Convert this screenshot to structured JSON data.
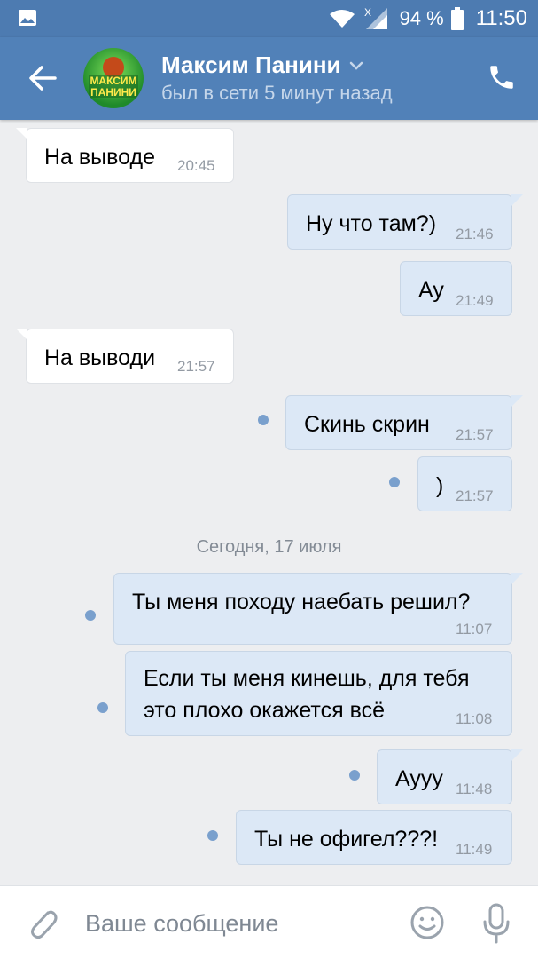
{
  "status_bar": {
    "battery_percent": "94 %",
    "time": "11:50"
  },
  "header": {
    "contact_name": "Максим Панини",
    "contact_status": "был в сети 5 минут назад",
    "avatar_text_line1": "МАКСИМ",
    "avatar_text_line2": "ПАНИНИ"
  },
  "messages": [
    {
      "direction": "in",
      "text": "На выводе",
      "time": "20:45"
    },
    {
      "direction": "out",
      "text": "Ну что там?)",
      "time": "21:46"
    },
    {
      "direction": "out",
      "text": "Ау",
      "time": "21:49"
    },
    {
      "direction": "in",
      "text": "На выводи",
      "time": "21:57"
    },
    {
      "direction": "out",
      "text": "Скинь скрин",
      "time": "21:57",
      "unread": true
    },
    {
      "direction": "out",
      "text": ")",
      "time": "21:57",
      "unread": true
    },
    {
      "direction": "out",
      "text": "Ты меня походу наебать решил?",
      "time": "11:07",
      "unread": true
    },
    {
      "direction": "out",
      "text_line1": "Если ты меня кинешь, для тебя",
      "text_line2": "это плохо окажется всё",
      "time": "11:08",
      "unread": true
    },
    {
      "direction": "out",
      "text": "Аууу",
      "time": "11:48",
      "unread": true
    },
    {
      "direction": "out",
      "text": "Ты не офигел???!",
      "time": "11:49",
      "unread": true
    }
  ],
  "date_separator": "Сегодня, 17 июля",
  "composer": {
    "placeholder": "Ваше сообщение",
    "icons": [
      "attach-icon",
      "emoji-icon",
      "microphone-icon"
    ]
  },
  "colors": {
    "header_bg": "#5181b8",
    "outgoing_bubble": "#dce8f6",
    "incoming_bubble": "#ffffff",
    "unread_dot": "#7aa0cd"
  }
}
